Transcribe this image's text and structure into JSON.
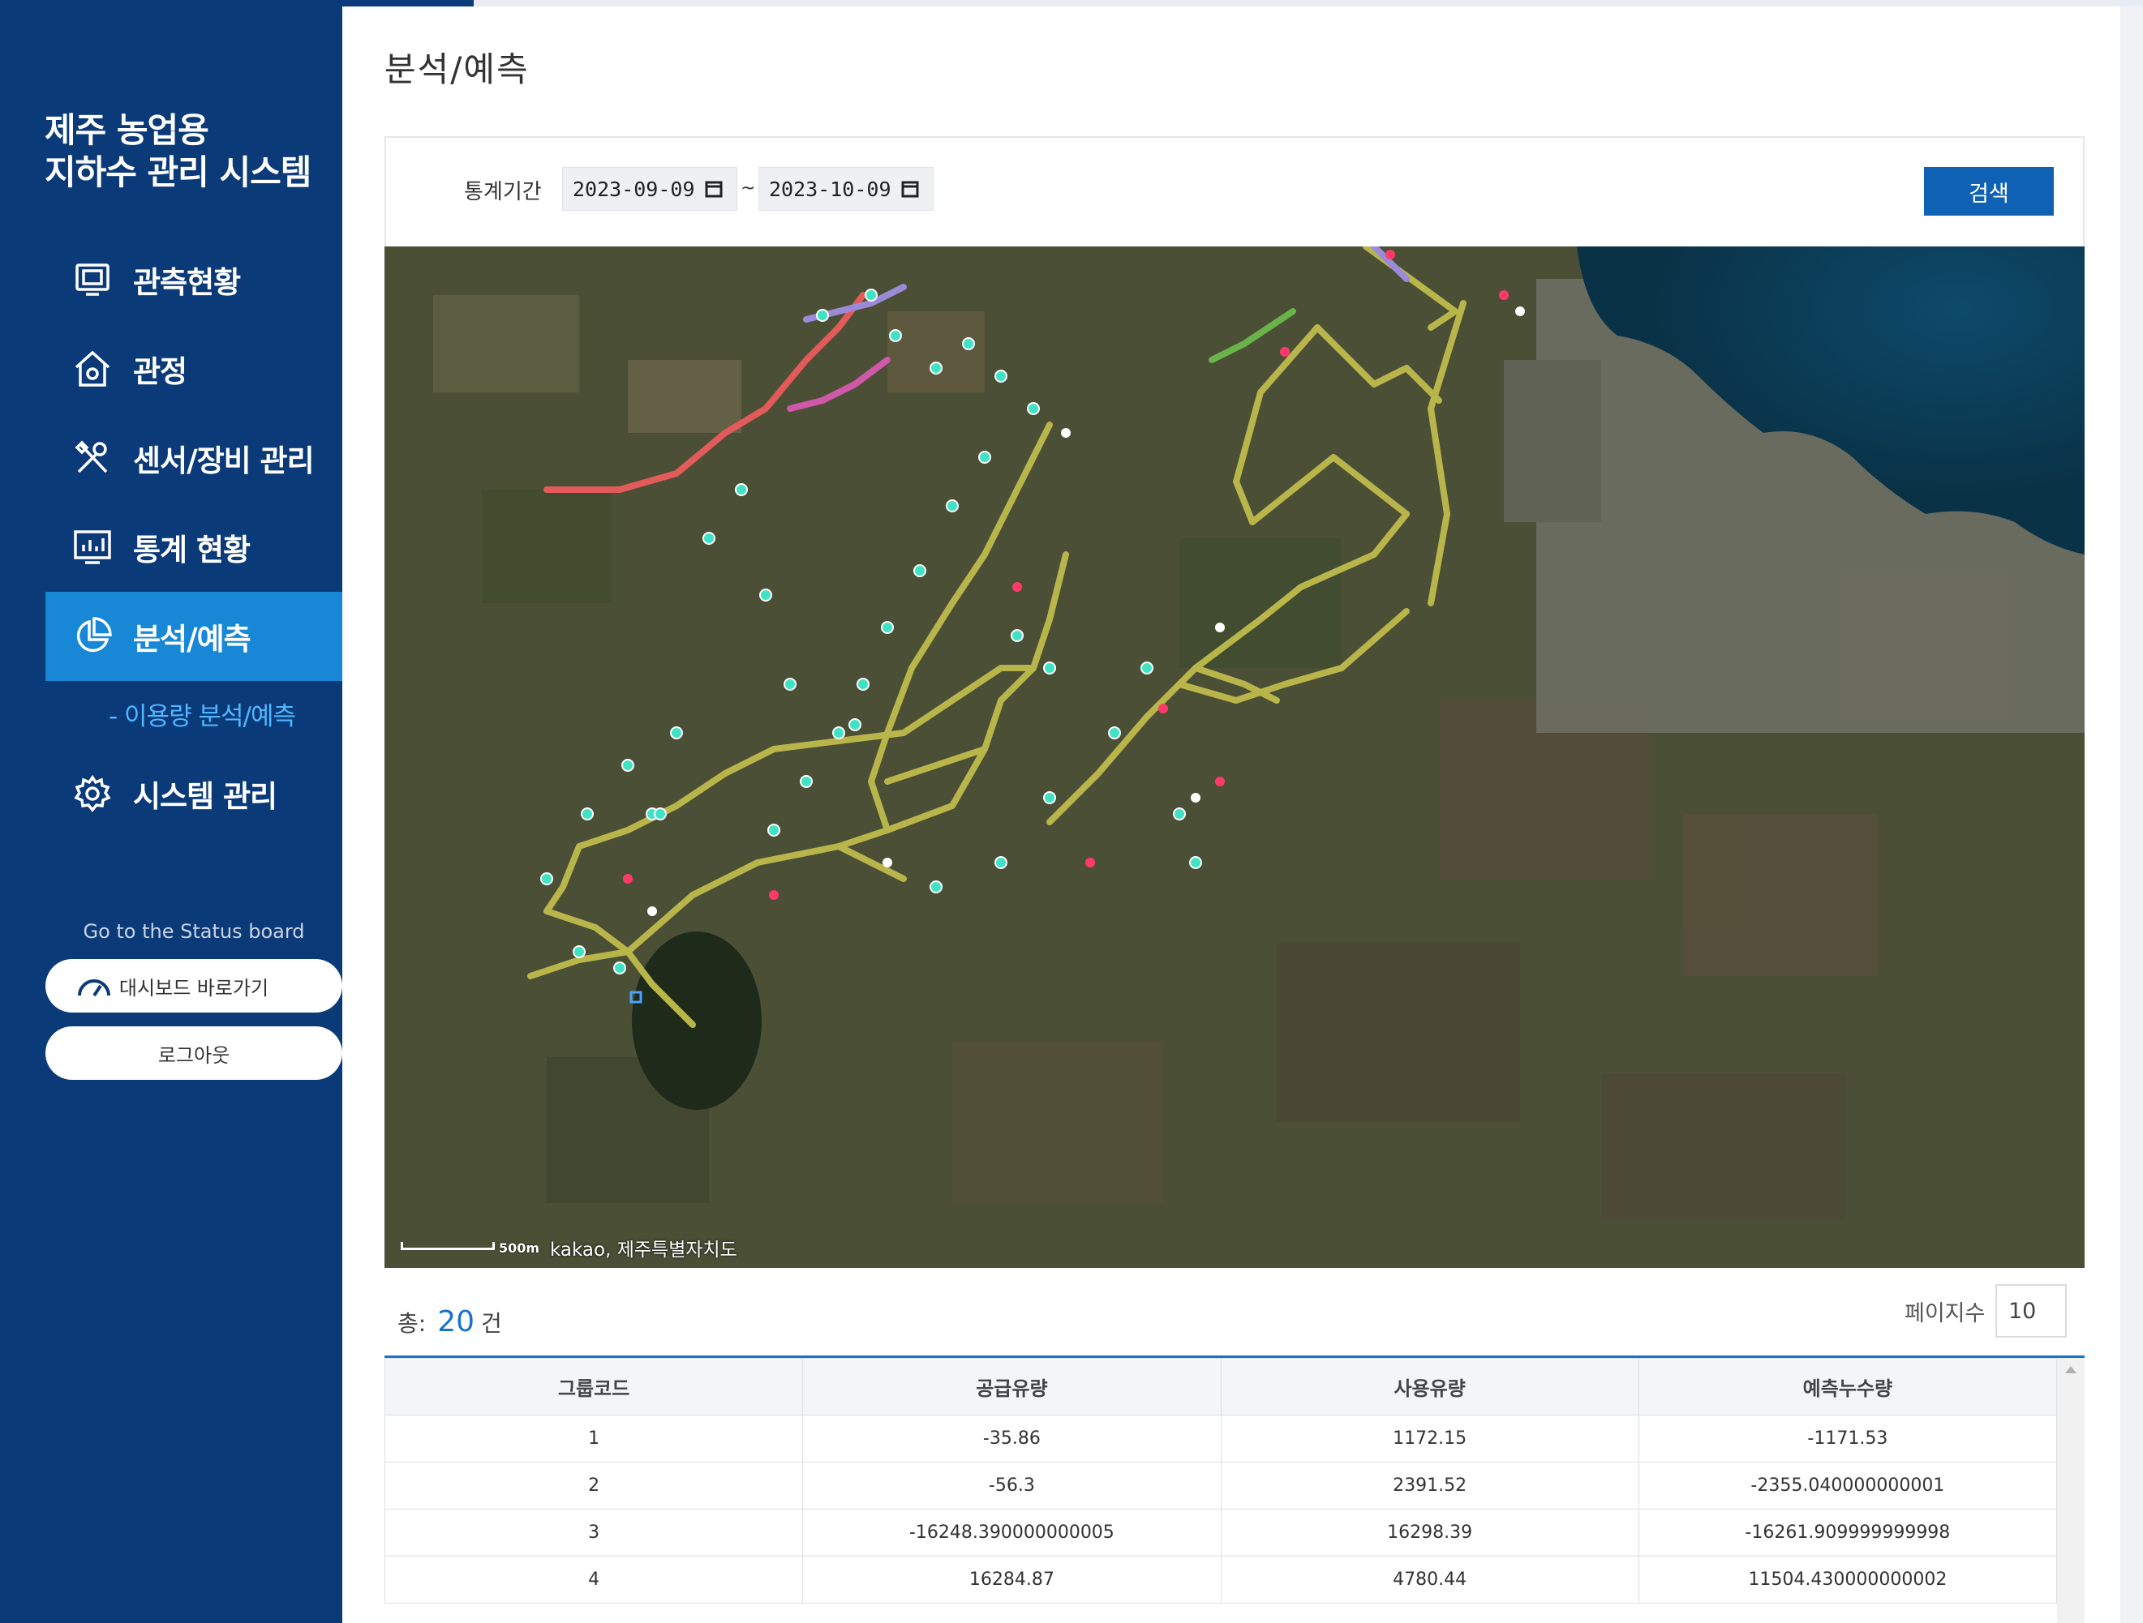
{
  "app": {
    "title_line1": "제주 농업용",
    "title_line2": "지하수 관리 시스템"
  },
  "sidebar": {
    "items": [
      {
        "label": "관측현황",
        "icon": "monitor-icon"
      },
      {
        "label": "관정",
        "icon": "house-icon"
      },
      {
        "label": "센서/장비 관리",
        "icon": "tools-icon"
      },
      {
        "label": "통계 현황",
        "icon": "chart-icon"
      },
      {
        "label": "분석/예측",
        "icon": "pie-chart-icon",
        "active": true
      },
      {
        "label": "시스템 관리",
        "icon": "gear-icon"
      }
    ],
    "sub_item": "- 이용량 분석/예측",
    "goto_text": "Go to the Status board",
    "dashboard_button": "대시보드 바로가기",
    "logout_button": "로그아웃"
  },
  "page": {
    "title": "분석/예측"
  },
  "search": {
    "period_label": "통계기간",
    "start_date": "2023-09-09",
    "end_date": "2023-10-09",
    "separator": "~",
    "button": "검색"
  },
  "map": {
    "attribution": "kakao, 제주특별자치도",
    "scale": "500m"
  },
  "summary": {
    "total_prefix": "총:",
    "total_count": "20",
    "total_suffix": "건",
    "page_size_label": "페이지수",
    "page_size": "10"
  },
  "table": {
    "headers": [
      "그룹코드",
      "공급유량",
      "사용유량",
      "예측누수량"
    ],
    "rows": [
      [
        "1",
        "-35.86",
        "1172.15",
        "-1171.53"
      ],
      [
        "2",
        "-56.3",
        "2391.52",
        "-2355.040000000001"
      ],
      [
        "3",
        "-16248.390000000005",
        "16298.39",
        "-16261.909999999998"
      ],
      [
        "4",
        "16284.87",
        "4780.44",
        "11504.430000000002"
      ]
    ]
  },
  "colors": {
    "sidebar_bg": "#0b3a78",
    "active_bg": "#1787d6",
    "accent": "#1a73c8",
    "button": "#0f62b3"
  }
}
